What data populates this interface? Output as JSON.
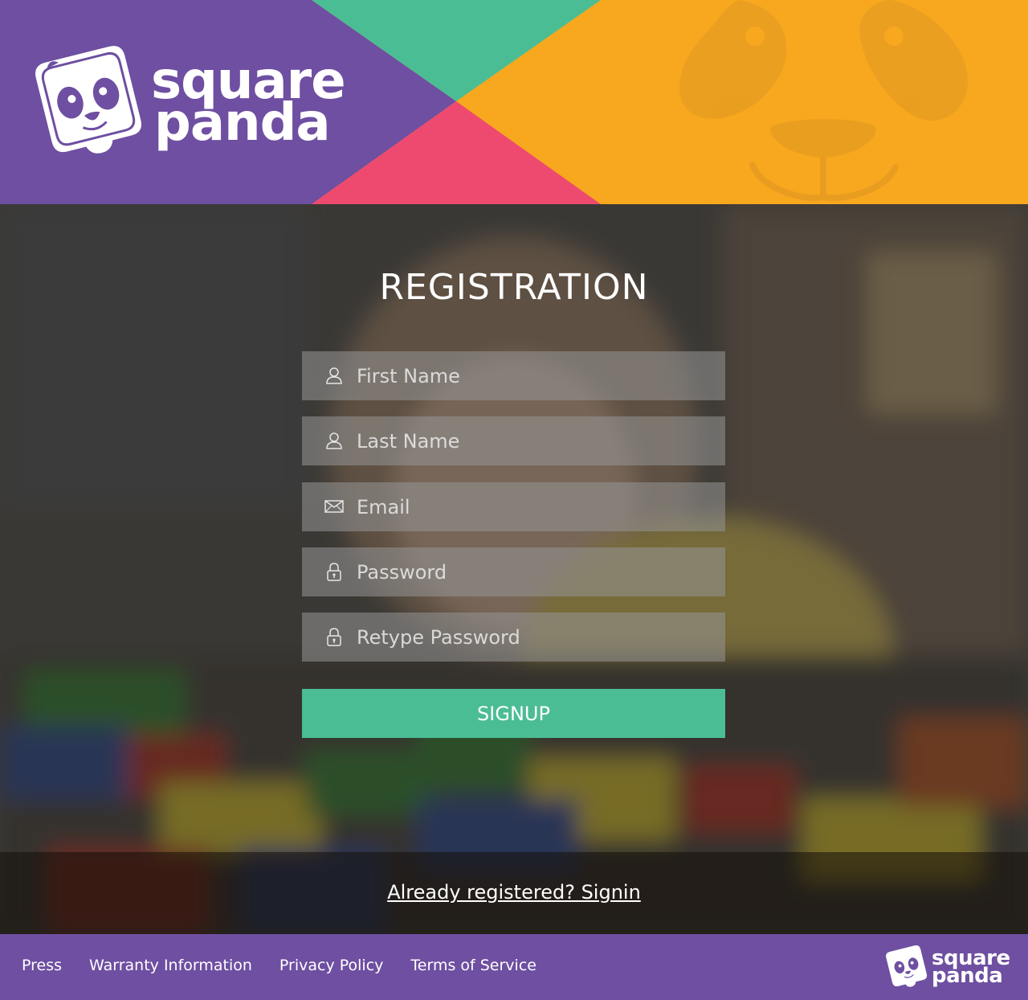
{
  "brand": {
    "line1": "square",
    "line2": "panda"
  },
  "colors": {
    "purple": "#6e4fa1",
    "teal": "#4bbd95",
    "pink": "#ee4a6f",
    "orange": "#f7a81e"
  },
  "registration": {
    "title": "REGISTRATION",
    "fields": [
      {
        "placeholder": "First Name",
        "icon": "user-icon"
      },
      {
        "placeholder": "Last Name",
        "icon": "user-icon"
      },
      {
        "placeholder": "Email",
        "icon": "envelope-icon"
      },
      {
        "placeholder": "Password",
        "icon": "lock-icon"
      },
      {
        "placeholder": "Retype Password",
        "icon": "lock-icon"
      }
    ],
    "submit_label": "SIGNUP"
  },
  "signin": {
    "text": "Already registered? Signin"
  },
  "footer": {
    "links": [
      "Press",
      "Warranty Information",
      "Privacy Policy",
      "Terms of Service"
    ]
  }
}
